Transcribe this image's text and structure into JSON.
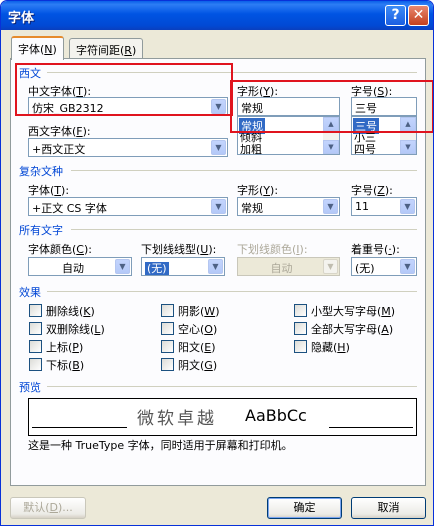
{
  "window": {
    "title": "字体",
    "help_glyph": "?",
    "close_glyph": "✕"
  },
  "tabs": [
    {
      "label": "字体",
      "key": "N",
      "paren_open": "(",
      "paren_close": ")"
    },
    {
      "label": "字符间距",
      "key": "R",
      "paren_open": "(",
      "paren_close": ")"
    }
  ],
  "western": {
    "group": "西文",
    "cn_font_label": "中文字体",
    "cn_font_key": "T",
    "cn_font_value": "仿宋_GB2312",
    "west_font_label": "西文字体",
    "west_font_key": "F",
    "west_font_value": "+西文正文",
    "style_label": "字形",
    "style_key": "Y",
    "style_value": "常规",
    "style_list": [
      "常规",
      "倾斜",
      "加粗"
    ],
    "size_label": "字号",
    "size_key": "S",
    "size_value": "三号",
    "size_list": [
      "三号",
      "小三",
      "四号"
    ]
  },
  "complex": {
    "group": "复杂文种",
    "font_label": "字体",
    "font_key": "T",
    "font_value": "+正文 CS 字体",
    "style_label": "字形",
    "style_key": "Y",
    "style_value": "常规",
    "size_label": "字号",
    "size_key": "Z",
    "size_value": "11"
  },
  "all_text": {
    "group": "所有文字",
    "color_label": "字体颜色",
    "color_key": "C",
    "color_value": "自动",
    "underline_label": "下划线线型",
    "underline_key": "U",
    "underline_value": "(无)",
    "ucolor_label": "下划线颜色",
    "ucolor_key": "I",
    "ucolor_value": "自动",
    "emph_label": "着重号",
    "emph_key": "·",
    "emph_value": "(无)"
  },
  "effects": {
    "group": "效果",
    "items": [
      {
        "label": "删除线",
        "key": "K"
      },
      {
        "label": "双删除线",
        "key": "L"
      },
      {
        "label": "上标",
        "key": "P"
      },
      {
        "label": "下标",
        "key": "B"
      },
      {
        "label": "阴影",
        "key": "W"
      },
      {
        "label": "空心",
        "key": "O"
      },
      {
        "label": "阳文",
        "key": "E"
      },
      {
        "label": "阴文",
        "key": "G"
      },
      {
        "label": "小型大写字母",
        "key": "M"
      },
      {
        "label": "全部大写字母",
        "key": "A"
      },
      {
        "label": "隐藏",
        "key": "H"
      }
    ]
  },
  "preview": {
    "group": "预览",
    "sample_cn": "微软卓越",
    "sample_en": "AaBbCc",
    "description": "这是一种 TrueType 字体，同时适用于屏幕和打印机。"
  },
  "buttons": {
    "default_label": "默认",
    "default_key": "D",
    "default_suffix": "...",
    "ok_label": "确定",
    "cancel_label": "取消"
  },
  "colors": {
    "title_bar": "#0054e3",
    "group_text": "#0046d5",
    "selection": "#316ac5",
    "highlight_box": "#e0141e"
  }
}
